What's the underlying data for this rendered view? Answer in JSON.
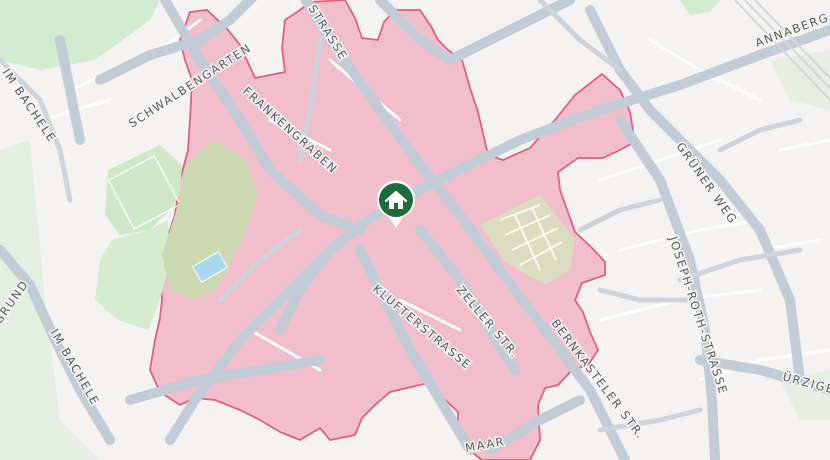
{
  "map": {
    "marker": {
      "icon": "home-icon",
      "color": "#1e6b3a"
    },
    "area_fill": "#f1b9c6",
    "area_stroke": "#e0607e",
    "street_labels": {
      "strasse_top": "STRASSE",
      "schwalbengarten": "SCHWALBENGARTEN",
      "frankengraben": "FRANKENGRABEN",
      "annaberg": "ANNABERG",
      "gruner_weg": "GRÜNER WEG",
      "joseph_roth": "JOSEPH-ROTH-STRASSE",
      "im_bachele_top": "IM BACHELE",
      "im_bachele_bottom": "IM BACHELE",
      "grund": "GRUND",
      "klufterstrasse": "KLUFTERSTRASSE",
      "zeller": "ZELLER STR.",
      "bernkasteler": "BERNKASTELER STR.",
      "urziger": "ÜRZIGER",
      "maar": "MAAR"
    }
  }
}
